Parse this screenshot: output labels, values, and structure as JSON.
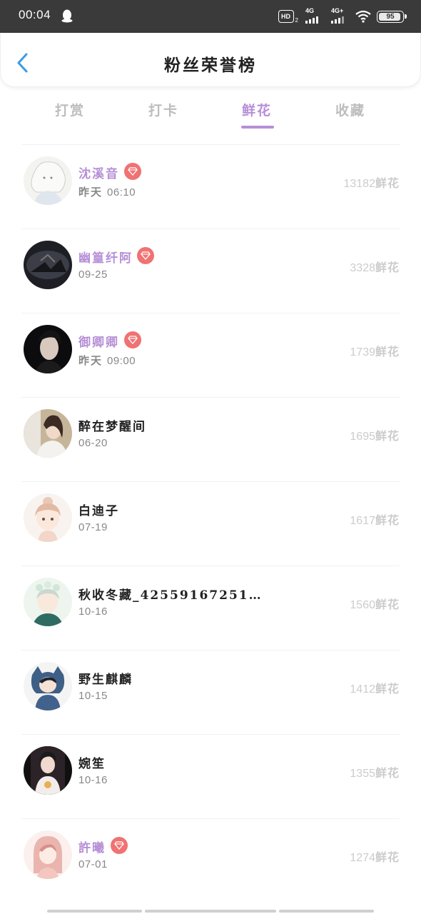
{
  "status_bar": {
    "time": "00:04",
    "hd_label": "HD",
    "hd_sub": "2",
    "signal1_label": "4G",
    "signal2_label": "4G+",
    "battery": "95"
  },
  "header": {
    "title": "粉丝荣誉榜",
    "back_icon": "chevron-left-icon"
  },
  "tabs": [
    {
      "label": "打赏",
      "active": false
    },
    {
      "label": "打卡",
      "active": false
    },
    {
      "label": "鲜花",
      "active": true
    },
    {
      "label": "收藏",
      "active": false
    }
  ],
  "fans": [
    {
      "name": "沈溪音",
      "vip": true,
      "date_prefix": "昨天",
      "date": "06:10",
      "amount": "13182",
      "unit": "鲜花"
    },
    {
      "name": "幽篁纤阿",
      "vip": true,
      "date_prefix": "",
      "date": "09-25",
      "amount": "3328",
      "unit": "鲜花"
    },
    {
      "name": "御卿卿",
      "vip": true,
      "date_prefix": "昨天",
      "date": "09:00",
      "amount": "1739",
      "unit": "鲜花"
    },
    {
      "name": "醉在梦醒间",
      "vip": false,
      "date_prefix": "",
      "date": "06-20",
      "amount": "1695",
      "unit": "鲜花"
    },
    {
      "name": "白迪子",
      "vip": false,
      "date_prefix": "",
      "date": "07-19",
      "amount": "1617",
      "unit": "鲜花"
    },
    {
      "name": "秋收冬藏_42559167251…",
      "vip": false,
      "date_prefix": "",
      "date": "10-16",
      "amount": "1560",
      "unit": "鲜花"
    },
    {
      "name": "野生麒麟",
      "vip": false,
      "date_prefix": "",
      "date": "10-15",
      "amount": "1412",
      "unit": "鲜花"
    },
    {
      "name": "婉笙",
      "vip": false,
      "date_prefix": "",
      "date": "10-16",
      "amount": "1355",
      "unit": "鲜花"
    },
    {
      "name": "許曦",
      "vip": true,
      "date_prefix": "",
      "date": "07-01",
      "amount": "1274",
      "unit": "鲜花"
    }
  ],
  "colors": {
    "accent": "#b68fd6",
    "badge": "#f07272",
    "status_bar": "#3a3a3a",
    "back_arrow": "#3a9be8"
  }
}
